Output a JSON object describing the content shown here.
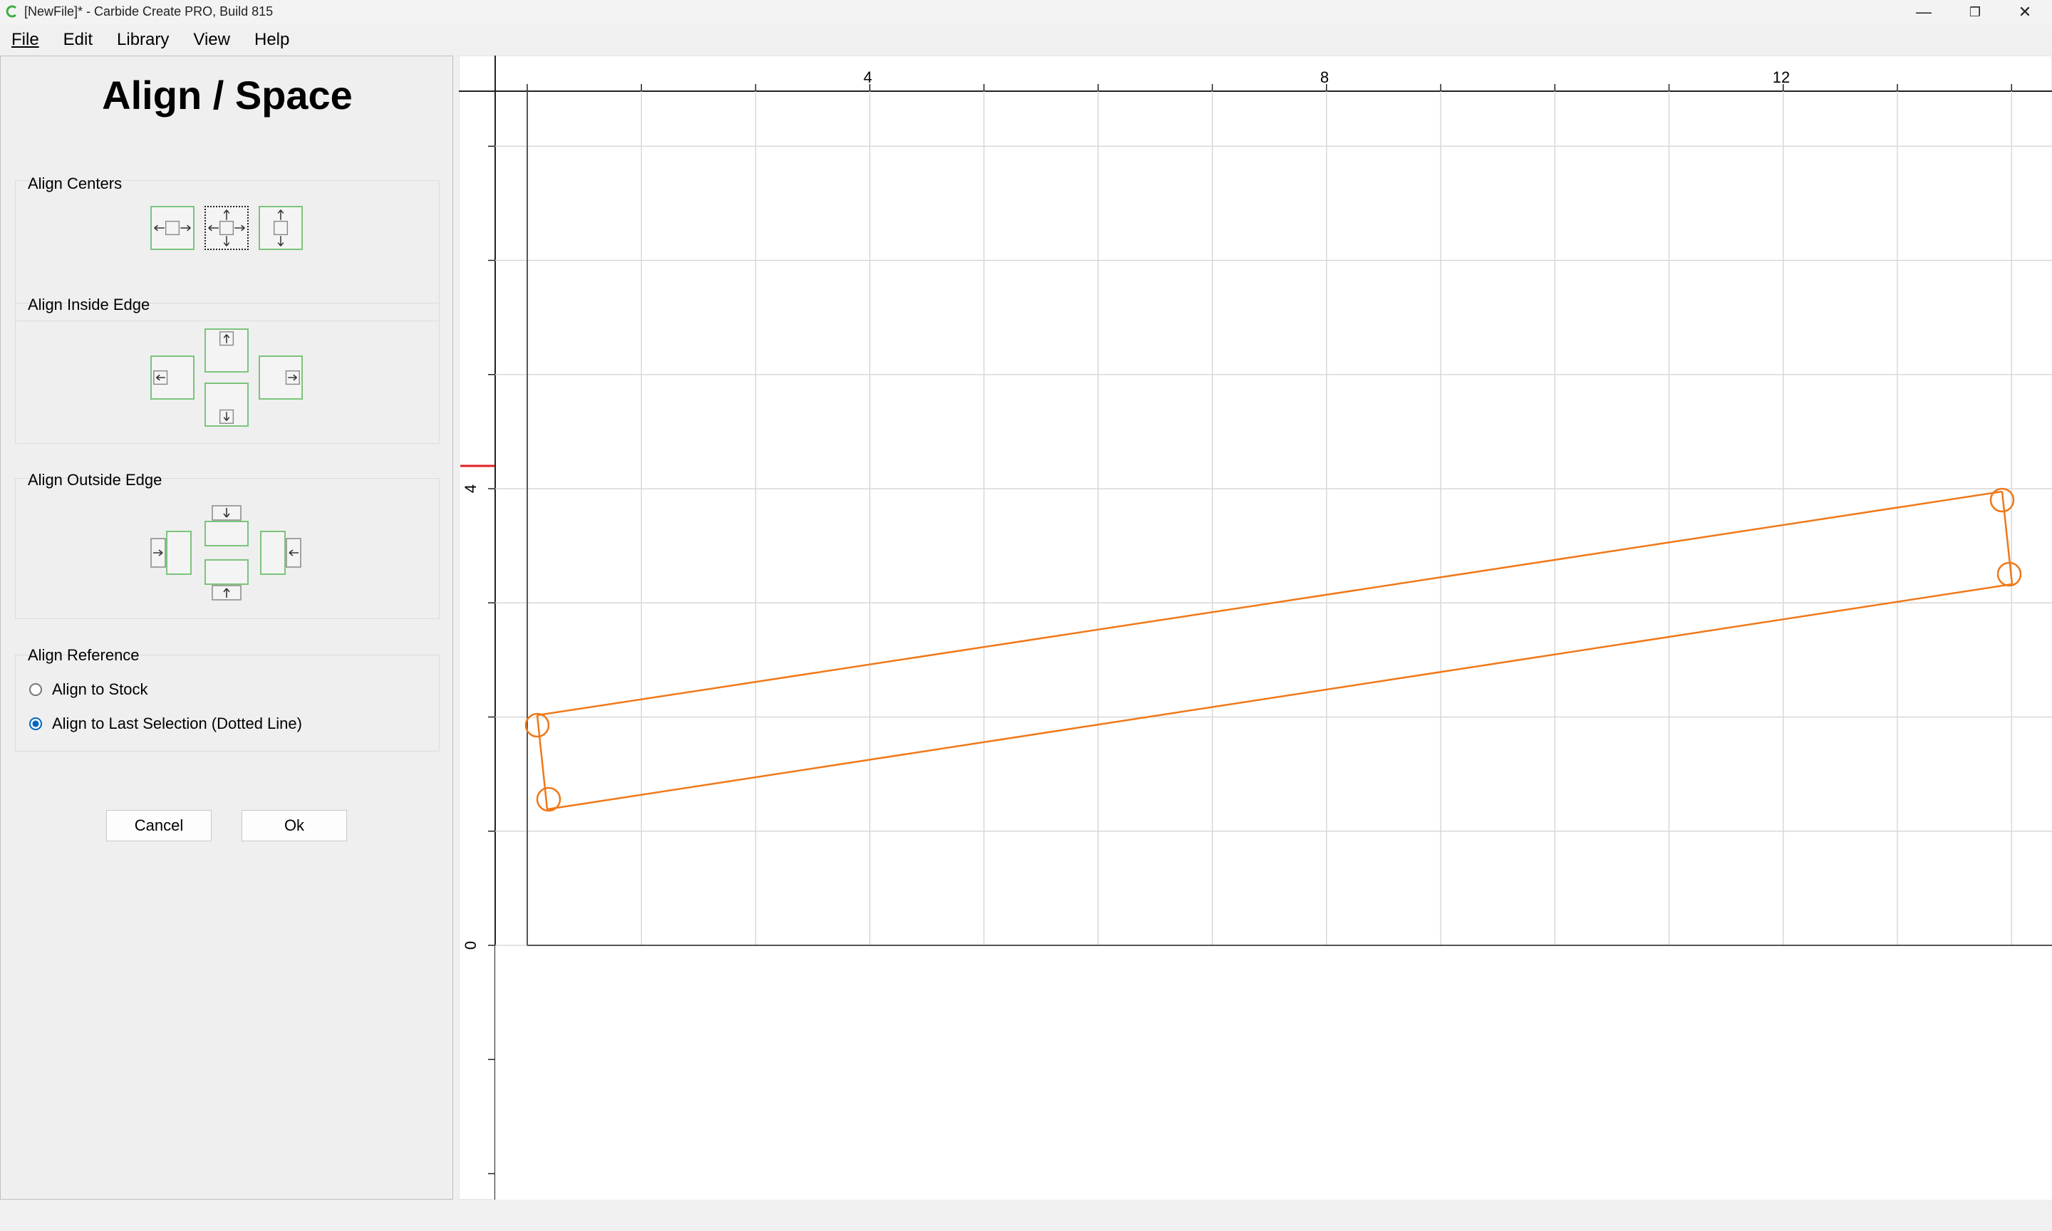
{
  "window": {
    "title": "[NewFile]* - Carbide Create PRO, Build 815",
    "minimize_glyph": "—",
    "restore_glyph": "❐",
    "close_glyph": "✕",
    "app_icon": "carbide-create-logo"
  },
  "menu": {
    "file": "File",
    "edit": "Edit",
    "library": "Library",
    "view": "View",
    "help": "Help"
  },
  "panel": {
    "title": "Align / Space",
    "align_centers_label": "Align Centers",
    "align_inside_label": "Align Inside Edge",
    "align_outside_label": "Align Outside Edge",
    "align_reference_label": "Align Reference",
    "radio_stock": "Align to Stock",
    "radio_last_selection": "Align to Last Selection (Dotted Line)",
    "selected_reference": "last_selection",
    "cancel": "Cancel",
    "ok": "Ok"
  },
  "ruler": {
    "x_labels": [
      "4",
      "8",
      "12"
    ],
    "y_labels": [
      "4",
      "0"
    ]
  },
  "colors": {
    "accent_green": "#7cc47c",
    "shape_orange": "#f07818",
    "radio_blue": "#0067c0",
    "ruler_marker_red": "#e02020"
  }
}
